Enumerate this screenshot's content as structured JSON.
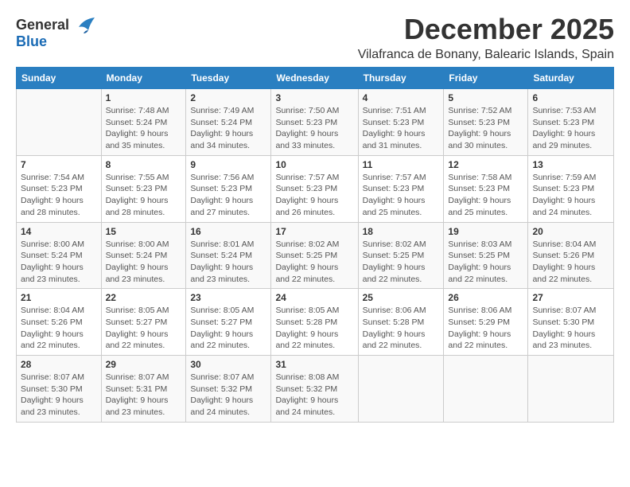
{
  "header": {
    "logo_general": "General",
    "logo_blue": "Blue",
    "month_title": "December 2025",
    "subtitle": "Vilafranca de Bonany, Balearic Islands, Spain"
  },
  "columns": [
    "Sunday",
    "Monday",
    "Tuesday",
    "Wednesday",
    "Thursday",
    "Friday",
    "Saturday"
  ],
  "weeks": [
    [
      {
        "day": "",
        "text": ""
      },
      {
        "day": "1",
        "text": "Sunrise: 7:48 AM\nSunset: 5:24 PM\nDaylight: 9 hours\nand 35 minutes."
      },
      {
        "day": "2",
        "text": "Sunrise: 7:49 AM\nSunset: 5:24 PM\nDaylight: 9 hours\nand 34 minutes."
      },
      {
        "day": "3",
        "text": "Sunrise: 7:50 AM\nSunset: 5:23 PM\nDaylight: 9 hours\nand 33 minutes."
      },
      {
        "day": "4",
        "text": "Sunrise: 7:51 AM\nSunset: 5:23 PM\nDaylight: 9 hours\nand 31 minutes."
      },
      {
        "day": "5",
        "text": "Sunrise: 7:52 AM\nSunset: 5:23 PM\nDaylight: 9 hours\nand 30 minutes."
      },
      {
        "day": "6",
        "text": "Sunrise: 7:53 AM\nSunset: 5:23 PM\nDaylight: 9 hours\nand 29 minutes."
      }
    ],
    [
      {
        "day": "7",
        "text": "Sunrise: 7:54 AM\nSunset: 5:23 PM\nDaylight: 9 hours\nand 28 minutes."
      },
      {
        "day": "8",
        "text": "Sunrise: 7:55 AM\nSunset: 5:23 PM\nDaylight: 9 hours\nand 28 minutes."
      },
      {
        "day": "9",
        "text": "Sunrise: 7:56 AM\nSunset: 5:23 PM\nDaylight: 9 hours\nand 27 minutes."
      },
      {
        "day": "10",
        "text": "Sunrise: 7:57 AM\nSunset: 5:23 PM\nDaylight: 9 hours\nand 26 minutes."
      },
      {
        "day": "11",
        "text": "Sunrise: 7:57 AM\nSunset: 5:23 PM\nDaylight: 9 hours\nand 25 minutes."
      },
      {
        "day": "12",
        "text": "Sunrise: 7:58 AM\nSunset: 5:23 PM\nDaylight: 9 hours\nand 25 minutes."
      },
      {
        "day": "13",
        "text": "Sunrise: 7:59 AM\nSunset: 5:23 PM\nDaylight: 9 hours\nand 24 minutes."
      }
    ],
    [
      {
        "day": "14",
        "text": "Sunrise: 8:00 AM\nSunset: 5:24 PM\nDaylight: 9 hours\nand 23 minutes."
      },
      {
        "day": "15",
        "text": "Sunrise: 8:00 AM\nSunset: 5:24 PM\nDaylight: 9 hours\nand 23 minutes."
      },
      {
        "day": "16",
        "text": "Sunrise: 8:01 AM\nSunset: 5:24 PM\nDaylight: 9 hours\nand 23 minutes."
      },
      {
        "day": "17",
        "text": "Sunrise: 8:02 AM\nSunset: 5:25 PM\nDaylight: 9 hours\nand 22 minutes."
      },
      {
        "day": "18",
        "text": "Sunrise: 8:02 AM\nSunset: 5:25 PM\nDaylight: 9 hours\nand 22 minutes."
      },
      {
        "day": "19",
        "text": "Sunrise: 8:03 AM\nSunset: 5:25 PM\nDaylight: 9 hours\nand 22 minutes."
      },
      {
        "day": "20",
        "text": "Sunrise: 8:04 AM\nSunset: 5:26 PM\nDaylight: 9 hours\nand 22 minutes."
      }
    ],
    [
      {
        "day": "21",
        "text": "Sunrise: 8:04 AM\nSunset: 5:26 PM\nDaylight: 9 hours\nand 22 minutes."
      },
      {
        "day": "22",
        "text": "Sunrise: 8:05 AM\nSunset: 5:27 PM\nDaylight: 9 hours\nand 22 minutes."
      },
      {
        "day": "23",
        "text": "Sunrise: 8:05 AM\nSunset: 5:27 PM\nDaylight: 9 hours\nand 22 minutes."
      },
      {
        "day": "24",
        "text": "Sunrise: 8:05 AM\nSunset: 5:28 PM\nDaylight: 9 hours\nand 22 minutes."
      },
      {
        "day": "25",
        "text": "Sunrise: 8:06 AM\nSunset: 5:28 PM\nDaylight: 9 hours\nand 22 minutes."
      },
      {
        "day": "26",
        "text": "Sunrise: 8:06 AM\nSunset: 5:29 PM\nDaylight: 9 hours\nand 22 minutes."
      },
      {
        "day": "27",
        "text": "Sunrise: 8:07 AM\nSunset: 5:30 PM\nDaylight: 9 hours\nand 23 minutes."
      }
    ],
    [
      {
        "day": "28",
        "text": "Sunrise: 8:07 AM\nSunset: 5:30 PM\nDaylight: 9 hours\nand 23 minutes."
      },
      {
        "day": "29",
        "text": "Sunrise: 8:07 AM\nSunset: 5:31 PM\nDaylight: 9 hours\nand 23 minutes."
      },
      {
        "day": "30",
        "text": "Sunrise: 8:07 AM\nSunset: 5:32 PM\nDaylight: 9 hours\nand 24 minutes."
      },
      {
        "day": "31",
        "text": "Sunrise: 8:08 AM\nSunset: 5:32 PM\nDaylight: 9 hours\nand 24 minutes."
      },
      {
        "day": "",
        "text": ""
      },
      {
        "day": "",
        "text": ""
      },
      {
        "day": "",
        "text": ""
      }
    ]
  ]
}
